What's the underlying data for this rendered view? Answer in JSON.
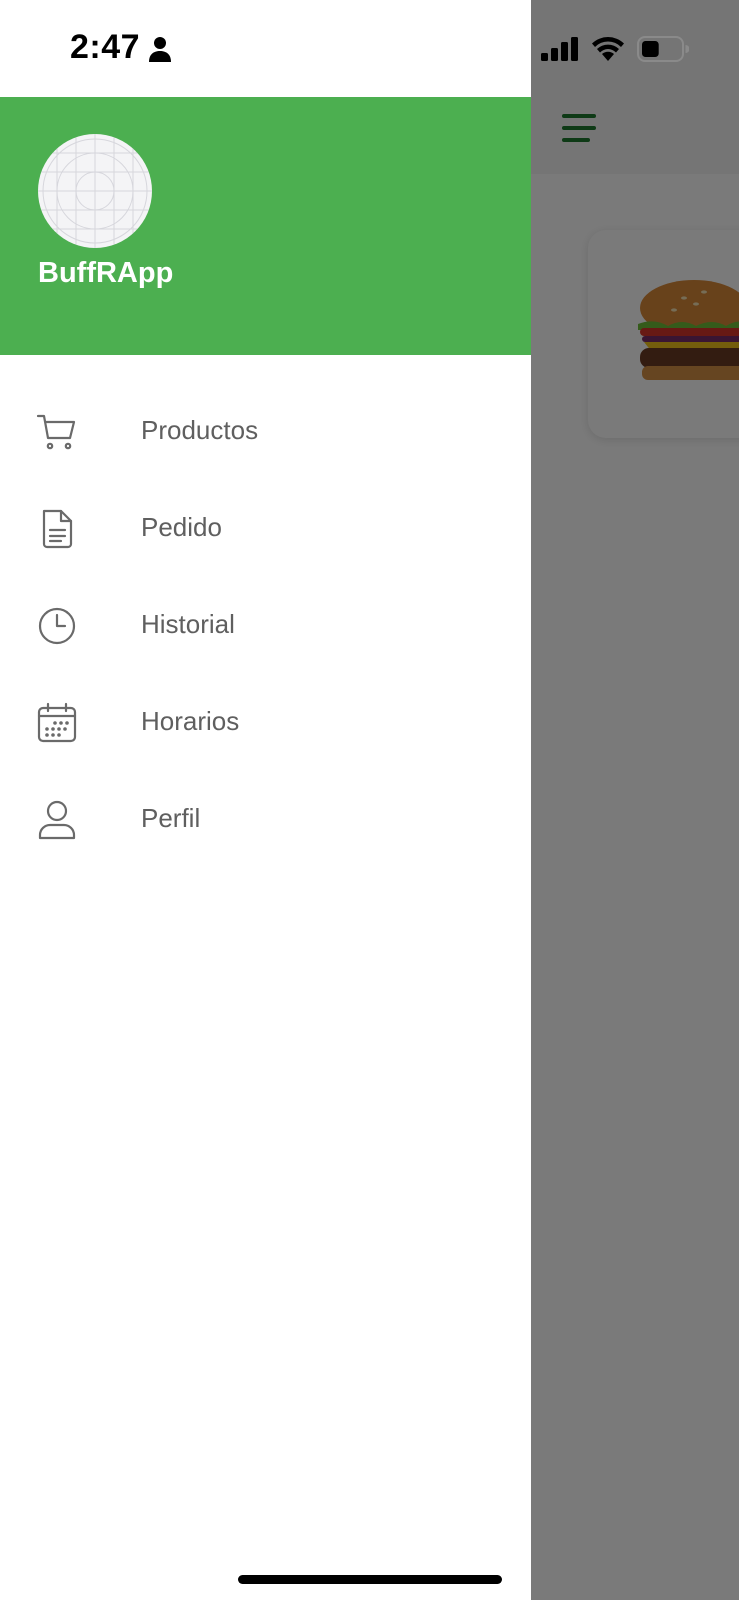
{
  "status_bar": {
    "time": "2:47",
    "icons": [
      "person-icon",
      "cellular-signal-icon",
      "wifi-icon",
      "battery-icon"
    ],
    "battery_level": 0.45
  },
  "drawer": {
    "app_name": "BuffRApp",
    "header_color": "#4caf50",
    "items": [
      {
        "label": "Productos",
        "icon": "cart-icon"
      },
      {
        "label": "Pedido",
        "icon": "document-icon"
      },
      {
        "label": "Historial",
        "icon": "clock-icon"
      },
      {
        "label": "Horarios",
        "icon": "calendar-icon"
      },
      {
        "label": "Perfil",
        "icon": "user-icon"
      }
    ]
  },
  "background_app": {
    "menu_icon": "hamburger-menu-icon",
    "accent_color": "#1e7a2e",
    "product_image": "burger-image"
  }
}
